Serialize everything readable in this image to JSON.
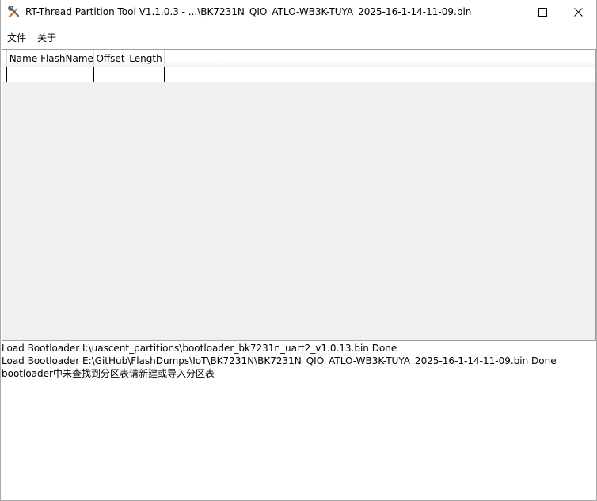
{
  "window": {
    "title": "RT-Thread Partition Tool V1.1.0.3 - ...\\BK7231N_QIO_ATLO-WB3K-TUYA_2025-16-1-14-11-09.bin",
    "app_icon": "tools-icon",
    "controls": {
      "minimize_icon": "minimize-icon",
      "maximize_icon": "maximize-icon",
      "close_icon": "close-icon"
    }
  },
  "menu": {
    "file": "文件",
    "about": "关于"
  },
  "table": {
    "columns": [
      "Name",
      "FlashName",
      "Offset",
      "Length"
    ],
    "rows": [
      [
        "",
        "",
        "",
        ""
      ]
    ]
  },
  "log": {
    "lines": [
      "Load Bootloader I:\\uascent_partitions\\bootloader_bk7231n_uart2_v1.0.13.bin Done",
      "Load Bootloader E:\\GitHub\\FlashDumps\\IoT\\BK7231N\\BK7231N_QIO_ATLO-WB3K-TUYA_2025-16-1-14-11-09.bin Done",
      "bootloader中未查找到分区表请新建或导入分区表"
    ]
  },
  "colors": {
    "table_background": "#f0f0f0",
    "icon_orange": "#e8731a",
    "icon_gray": "#555555"
  }
}
